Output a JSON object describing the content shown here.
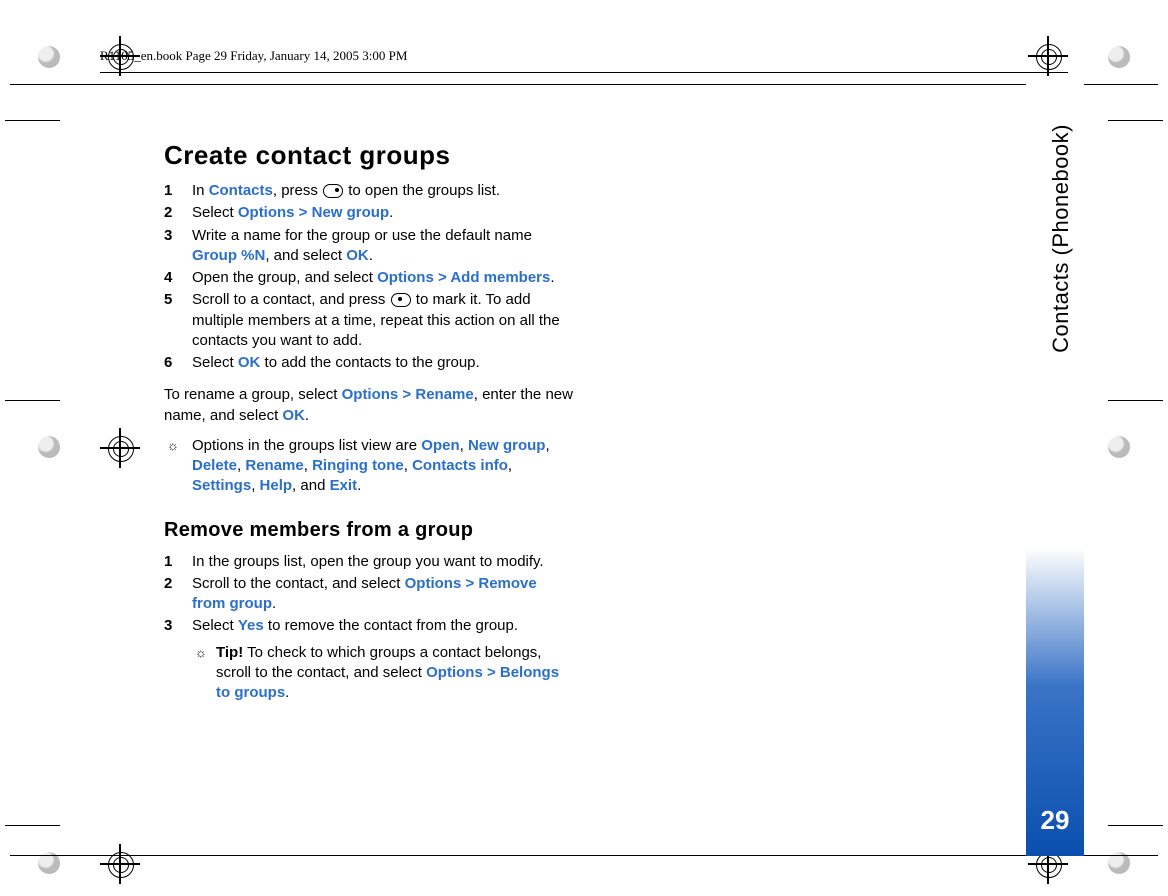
{
  "header": "R1105_en.book  Page 29  Friday, January 14, 2005  3:00 PM",
  "side": {
    "chapter": "Contacts (Phonebook)",
    "page_number": "29"
  },
  "section1": {
    "title": "Create contact groups",
    "steps": [
      {
        "n": "1",
        "pre": "In ",
        "hl1": "Contacts",
        "mid": ", press ",
        "icon": "right",
        "post": " to open the groups list."
      },
      {
        "n": "2",
        "pre": "Select ",
        "hl1": "Options > New group",
        "post": "."
      },
      {
        "n": "3",
        "pre": "Write a name for the group or use the default name ",
        "hl1": "Group %N",
        "mid": ", and select ",
        "hl2": "OK",
        "post": "."
      },
      {
        "n": "4",
        "pre": "Open the group, and select ",
        "hl1": "Options > Add members",
        "post": "."
      },
      {
        "n": "5",
        "pre": "Scroll to a contact, and press ",
        "icon": "center",
        "mid": " to mark it. To add multiple members at a time, repeat this action on all the contacts you want to add.",
        "post": ""
      },
      {
        "n": "6",
        "pre": "Select ",
        "hl1": "OK",
        "post": " to add the contacts to the group."
      }
    ],
    "rename_para": {
      "pre": "To rename a group, select ",
      "hl1": "Options > Rename",
      "mid": ", enter the new name, and select ",
      "hl2": "OK",
      "post": "."
    },
    "options_tip": {
      "pre": "Options in the groups list view are ",
      "items": [
        "Open",
        "New group",
        "Delete",
        "Rename",
        "Ringing tone",
        "Contacts info",
        "Settings",
        "Help"
      ],
      "and_word": ", and ",
      "last": "Exit",
      "post": "."
    }
  },
  "section2": {
    "title": "Remove members from a group",
    "steps": [
      {
        "n": "1",
        "pre": "In the groups list, open the group you want to modify.",
        "post": ""
      },
      {
        "n": "2",
        "pre": "Scroll to the contact, and select ",
        "hl1": "Options > Remove from group",
        "post": "."
      },
      {
        "n": "3",
        "pre": "Select ",
        "hl1": "Yes",
        "post": " to remove the contact from the group."
      }
    ],
    "tip": {
      "lead_bold": "Tip!",
      "pre": " To check to which groups a contact belongs, scroll to the contact, and select ",
      "hl1": "Options > Belongs to groups",
      "post": "."
    }
  }
}
